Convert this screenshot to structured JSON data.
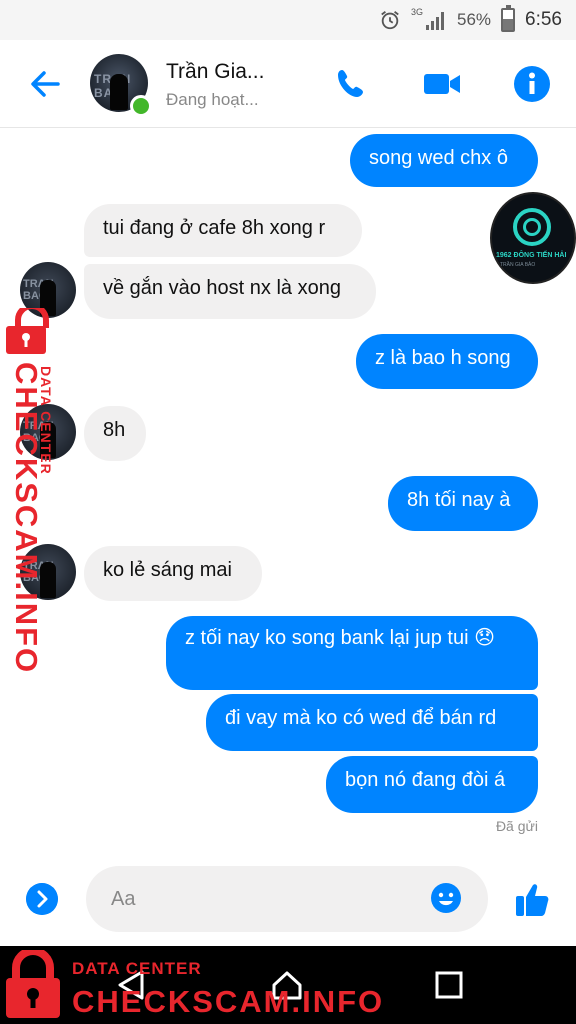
{
  "status_bar": {
    "network": "3G",
    "battery": "56%",
    "time": "6:56"
  },
  "header": {
    "contact_name": "Trần Gia...",
    "contact_status": "Đang hoạt...",
    "avatar_text": "TRAN BAO"
  },
  "messages": [
    {
      "side": "right",
      "text": "song wed chx ô"
    },
    {
      "side": "left",
      "text": "tui đang ở cafe 8h xong r"
    },
    {
      "side": "left",
      "text": "về gắn vào host nx là xong"
    },
    {
      "side": "right",
      "text": "z là bao h song"
    },
    {
      "side": "left",
      "text": "8h"
    },
    {
      "side": "right",
      "text": "8h tối nay à"
    },
    {
      "side": "left",
      "text": "ko lẻ sáng mai"
    },
    {
      "side": "right",
      "text": "z tối nay ko song bank lại jup tui 😞"
    },
    {
      "side": "right",
      "text": "đi vay mà ko có wed để bán rd"
    },
    {
      "side": "right",
      "text": "bọn nó đang đòi á"
    }
  ],
  "seen_avatar": {
    "brand": "1962 ĐÔNG TIẾN HẢI",
    "subtitle": "TRẦN GIA BẢO"
  },
  "sent_label": "Đã gửi",
  "composer": {
    "placeholder": "Aa"
  },
  "watermark": {
    "top": "DATA CENTER",
    "big": "CHECKSCAM.INFO"
  },
  "colors": {
    "accent": "#0084ff",
    "online": "#42b72a",
    "watermark": "#e8262d"
  }
}
